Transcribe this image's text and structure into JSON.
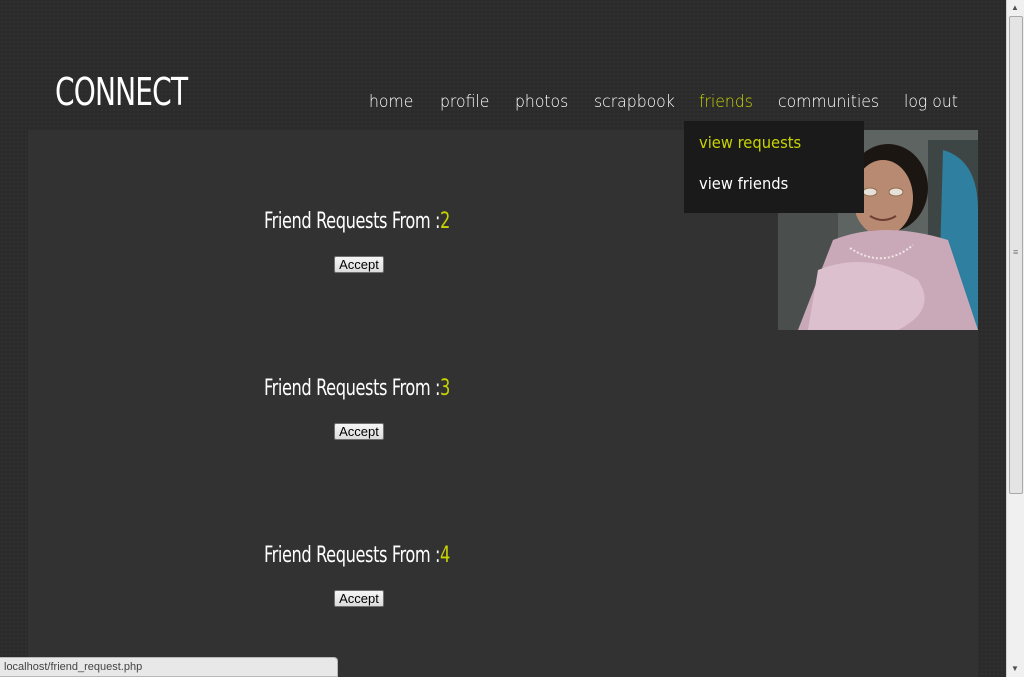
{
  "site": {
    "logo": "CONNECT"
  },
  "nav": {
    "items": [
      {
        "label": "home"
      },
      {
        "label": "profile"
      },
      {
        "label": "photos"
      },
      {
        "label": "scrapbook"
      },
      {
        "label": "friends",
        "active": true
      },
      {
        "label": "communities"
      },
      {
        "label": "log out"
      }
    ]
  },
  "dropdown": {
    "items": [
      {
        "label": "view requests",
        "active": true
      },
      {
        "label": "view friends"
      }
    ]
  },
  "requests": [
    {
      "prefix": "Friend Requests From :",
      "from_id": "2",
      "button": "Accept"
    },
    {
      "prefix": "Friend Requests From :",
      "from_id": "3",
      "button": "Accept"
    },
    {
      "prefix": "Friend Requests From :",
      "from_id": "4",
      "button": "Accept"
    }
  ],
  "status": {
    "url": "localhost/friend_request.php"
  },
  "colors": {
    "accent": "#c8d400",
    "background": "#2b2b2b",
    "panel": "#323232",
    "dropdown": "#1a1a1a"
  }
}
